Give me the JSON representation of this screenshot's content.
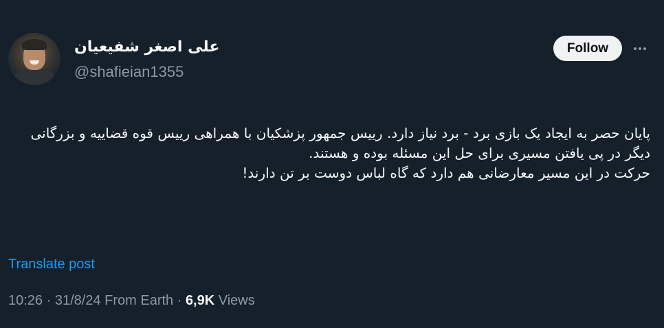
{
  "author": {
    "display_name": "علی اصغر شفیعیان",
    "handle": "@shafieian1355"
  },
  "actions": {
    "follow_label": "Follow",
    "more_icon": "more-horizontal-icon"
  },
  "tweet": {
    "paragraph_1": "پایان حصر به ایجاد یک بازی برد - برد نیاز دارد. رییس جمهور پزشکیان با همراهی رییس قوه قضاییه و بزرگانی دیگر در پی یافتن مسیری برای حل این مسئله بوده و هستند.",
    "paragraph_2": "حرکت در این مسیر معارضانی هم دارد که گاه لباس دوست بر تن دارند!"
  },
  "translate_label": "Translate post",
  "meta": {
    "time": "10:26",
    "sep1": " · ",
    "date": "31/8/24",
    "source": " From Earth",
    "sep2": " · ",
    "views_count": "6,9K",
    "views_label": " Views"
  },
  "colors": {
    "background": "#15202b",
    "text_primary": "#f7f9f9",
    "text_secondary": "#8b98a5",
    "link": "#1d9bf0",
    "follow_bg": "#eff3f4"
  }
}
